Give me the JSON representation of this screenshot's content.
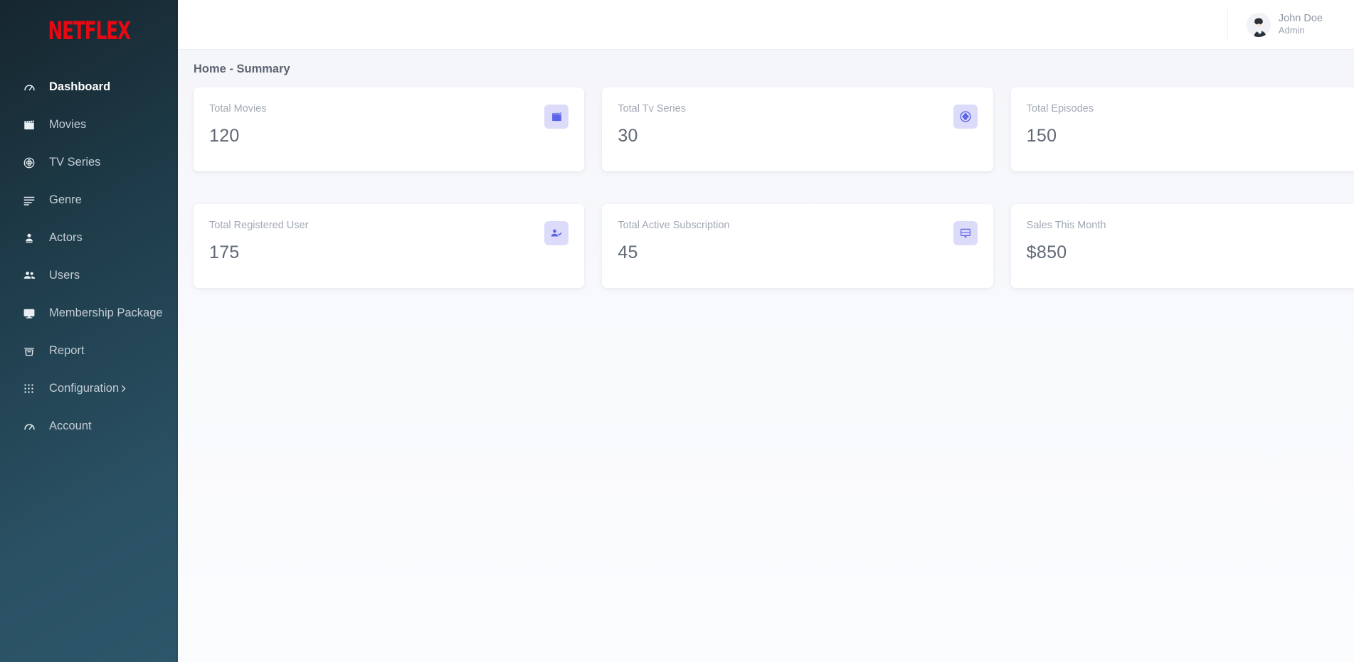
{
  "sidebar": {
    "brand": "NETFLEX",
    "items": [
      {
        "label": "Dashboard",
        "icon": "speedometer-icon",
        "active": true,
        "chevron": false
      },
      {
        "label": "Movies",
        "icon": "clapperboard-icon",
        "active": false,
        "chevron": false
      },
      {
        "label": "TV Series",
        "icon": "film-reel-icon",
        "active": false,
        "chevron": false
      },
      {
        "label": "Genre",
        "icon": "list-lines-icon",
        "active": false,
        "chevron": false
      },
      {
        "label": "Actors",
        "icon": "person-icon",
        "active": false,
        "chevron": false
      },
      {
        "label": "Users",
        "icon": "people-icon",
        "active": false,
        "chevron": false
      },
      {
        "label": "Membership Package",
        "icon": "monitor-icon",
        "active": false,
        "chevron": false
      },
      {
        "label": "Report",
        "icon": "archive-box-icon",
        "active": false,
        "chevron": false
      },
      {
        "label": "Configuration",
        "icon": "grid-apps-icon",
        "active": false,
        "chevron": true
      },
      {
        "label": "Account",
        "icon": "speedometer-icon",
        "active": false,
        "chevron": false
      }
    ]
  },
  "topbar": {
    "user_name": "John Doe",
    "user_role": "Admin",
    "avatar_icon": "user-avatar-illustration"
  },
  "main": {
    "page_title": "Home - Summary",
    "cards": [
      {
        "label": "Total Movies",
        "value": "120",
        "icon": "clapperboard-icon"
      },
      {
        "label": "Total Tv Series",
        "value": "30",
        "icon": "film-reel-icon"
      },
      {
        "label": "Total Episodes",
        "value": "150",
        "icon": "copy-layers-icon"
      },
      {
        "label": "Total Registered User",
        "value": "175",
        "icon": "person-check-icon"
      },
      {
        "label": "Total Active Subscription",
        "value": "45",
        "icon": "monitor-icon"
      },
      {
        "label": "Sales This Month",
        "value": "$850",
        "icon": "dollar-square-icon"
      }
    ]
  },
  "colors": {
    "brand_red": "#e50914",
    "sidebar_dark": "#16262e",
    "sidebar_light": "#2d566a",
    "accent_purple": "#5c63ea",
    "badge_bg": "#dcdcfa",
    "content_bg": "#f7f8fb",
    "value_text": "#5f6874",
    "label_text": "#a2a8b4"
  }
}
